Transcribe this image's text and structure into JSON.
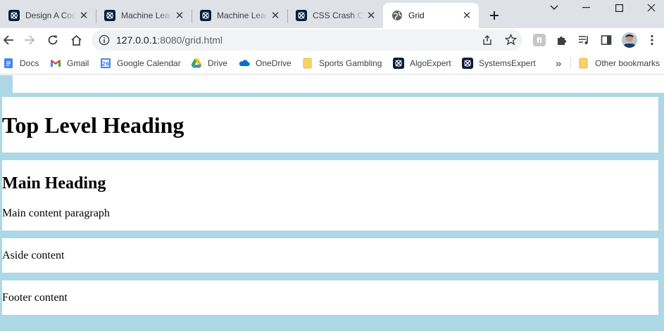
{
  "browser": {
    "tabs": [
      {
        "title": "Design A Code Editor",
        "active": false
      },
      {
        "title": "Machine Learning Expert",
        "active": false
      },
      {
        "title": "Machine Learning Expert",
        "active": false
      },
      {
        "title": "CSS Crash Course",
        "active": false
      },
      {
        "title": "Grid",
        "active": true
      }
    ],
    "url_host": "127.0.0.1",
    "url_path": ":8080/grid.html"
  },
  "bookmarks": {
    "items": [
      "Docs",
      "Gmail",
      "Google Calendar",
      "Drive",
      "OneDrive",
      "Sports Gambling",
      "AlgoExpert",
      "SystemsExpert"
    ],
    "overflow": "»",
    "other": "Other bookmarks",
    "calendar_day": "26"
  },
  "page": {
    "top_heading": "Top Level Heading",
    "main_heading": "Main Heading",
    "main_paragraph": "Main content paragraph",
    "aside": "Aside content",
    "footer": "Footer content"
  },
  "colors": {
    "page_background": "#add8e6",
    "cell_background": "#ffffff",
    "tabstrip": "#dee1e6"
  }
}
